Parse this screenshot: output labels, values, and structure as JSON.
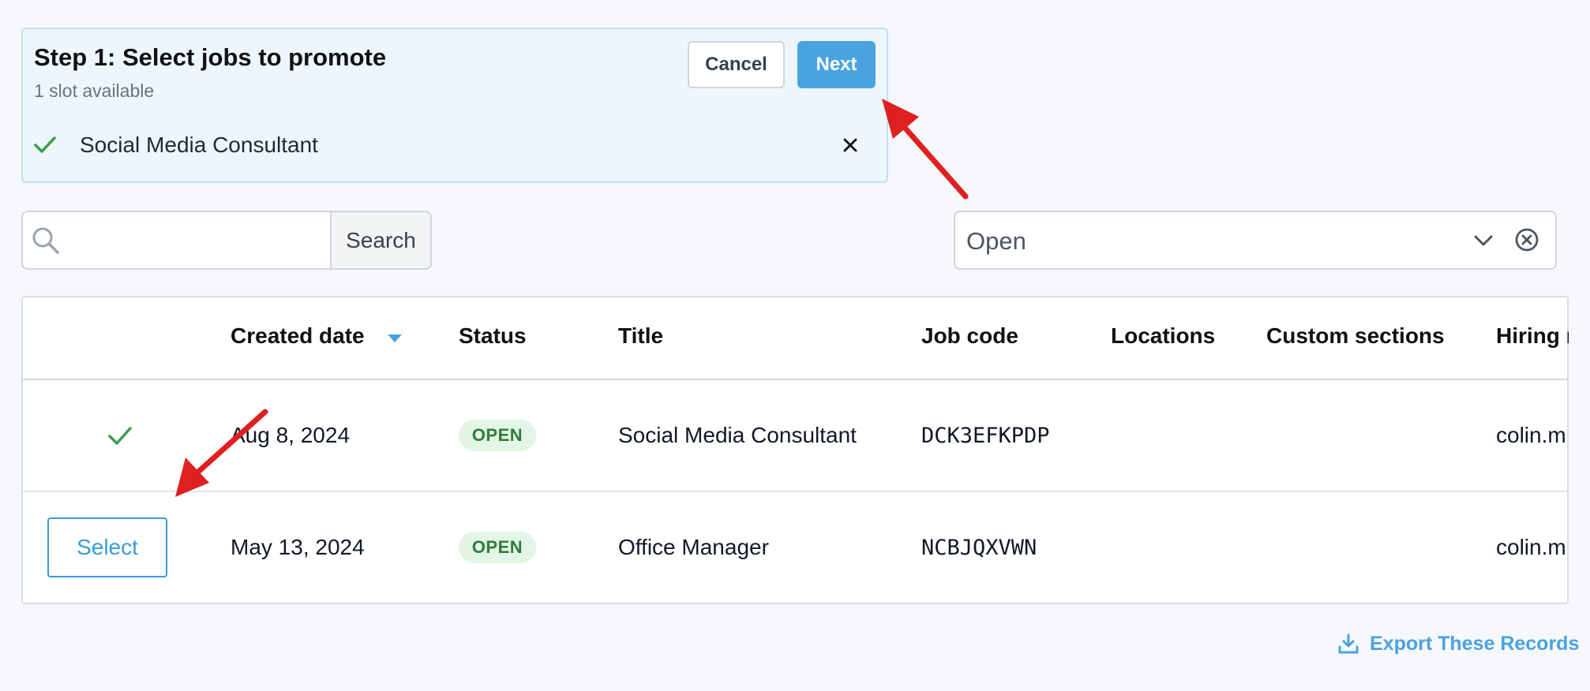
{
  "step": {
    "title": "Step 1: Select jobs to promote",
    "subtitle": "1 slot available",
    "cancel_label": "Cancel",
    "next_label": "Next",
    "selected_job": "Social Media Consultant"
  },
  "search": {
    "value": "",
    "placeholder": "",
    "button_label": "Search"
  },
  "status_filter": {
    "value": "Open"
  },
  "table": {
    "headers": {
      "created": "Created date",
      "status": "Status",
      "title": "Title",
      "code": "Job code",
      "locations": "Locations",
      "custom": "Custom sections",
      "hiring": "Hiring m"
    },
    "rows": [
      {
        "action": "selected",
        "created": "Aug 8, 2024",
        "status": "OPEN",
        "title": "Social Media Consultant",
        "code": "DCK3EFKPDP",
        "locations": "",
        "custom": "",
        "hiring": "colin.m"
      },
      {
        "action": "Select",
        "created": "May 13, 2024",
        "status": "OPEN",
        "title": "Office Manager",
        "code": "NCBJQXVWN",
        "locations": "",
        "custom": "",
        "hiring": "colin.m"
      }
    ]
  },
  "export": {
    "label": "Export These Records"
  },
  "colors": {
    "accent": "#4aa3e0",
    "panel_bg": "#eef6fd",
    "check_green": "#3f9e4b",
    "badge_bg": "#e2f5e6",
    "badge_text": "#2d7d3a",
    "annotation_arrow": "#e02020"
  },
  "icons": {
    "selected_check": "check-icon",
    "remove": "close-icon",
    "search": "search-icon",
    "dropdown": "chevron-down-icon",
    "clear": "circle-x-icon",
    "sort": "sort-down-icon",
    "export": "download-icon"
  }
}
